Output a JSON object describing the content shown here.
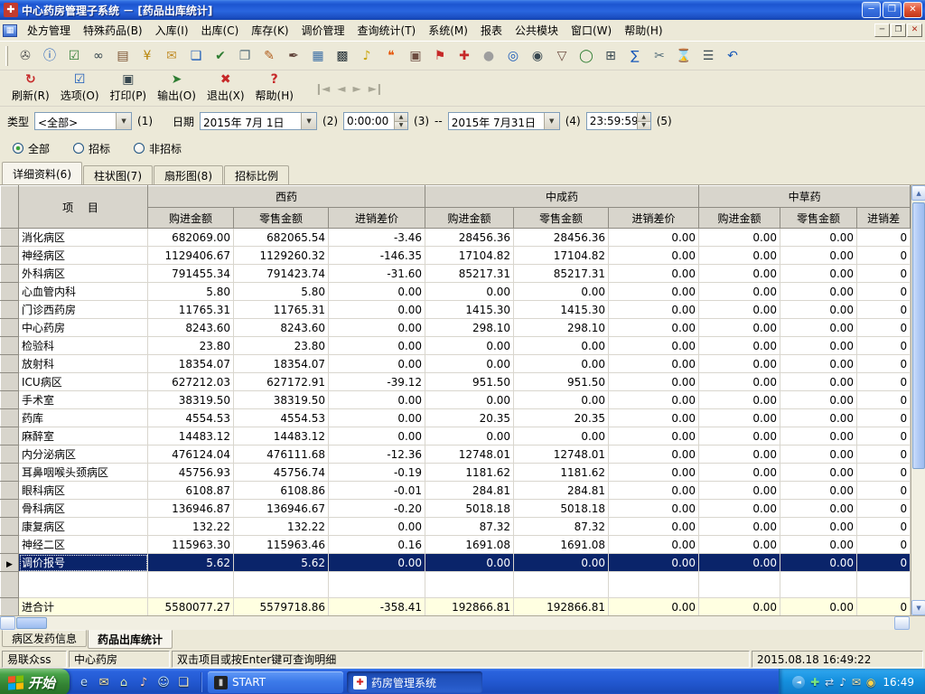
{
  "colors": {
    "window_face": "#ECE9D8",
    "header_bg": "#D8D5CC",
    "selection_bg": "#0A246A",
    "total_row_bg": "#FFFFE1",
    "grid_line": "#D9D6CE"
  },
  "window": {
    "title": "中心药房管理子系统 － [药品出库统计]",
    "icon_glyph": "✚",
    "controls": [
      {
        "name": "minimize-button",
        "glyph": "─"
      },
      {
        "name": "restore-button",
        "glyph": "❐"
      },
      {
        "name": "close-button",
        "glyph": "✕"
      }
    ]
  },
  "menubar": {
    "icon_glyph": "▦",
    "items": [
      "处方管理",
      "特殊药品(B)",
      "入库(I)",
      "出库(C)",
      "库存(K)",
      "调价管理",
      "查询统计(T)",
      "系统(M)",
      "报表",
      "公共模块",
      "窗口(W)",
      "帮助(H)"
    ],
    "controls": [
      {
        "name": "mdi-minimize-button",
        "glyph": "─"
      },
      {
        "name": "mdi-restore-button",
        "glyph": "❐"
      },
      {
        "name": "mdi-close-button",
        "glyph": "✕"
      }
    ]
  },
  "toolbar": {
    "icons": [
      {
        "name": "print-preview-icon",
        "glyph": "✇",
        "color": "#5A5A5A"
      },
      {
        "name": "info-icon",
        "glyph": "ⓘ",
        "color": "#1758B8"
      },
      {
        "name": "task-check-icon",
        "glyph": "☑",
        "color": "#2E7D32"
      },
      {
        "name": "binoculars-icon",
        "glyph": "∞",
        "color": "#37474F"
      },
      {
        "name": "ledger-icon",
        "glyph": "▤",
        "color": "#7A5230"
      },
      {
        "name": "cash-icon",
        "glyph": "¥",
        "color": "#B8860B"
      },
      {
        "name": "mail-icon",
        "glyph": "✉",
        "color": "#C28F2C"
      },
      {
        "name": "document-icon",
        "glyph": "❏",
        "color": "#1758B8"
      },
      {
        "name": "document-check-icon",
        "glyph": "✔",
        "color": "#2E7D32"
      },
      {
        "name": "copy-icon",
        "glyph": "❐",
        "color": "#546E7A"
      },
      {
        "name": "edit-icon",
        "glyph": "✎",
        "color": "#B05C1A"
      },
      {
        "name": "contract-icon",
        "glyph": "✒",
        "color": "#5D4037"
      },
      {
        "name": "report-icon",
        "glyph": "▦",
        "color": "#3A6EA5"
      },
      {
        "name": "barcode-icon",
        "glyph": "▩",
        "color": "#263238"
      },
      {
        "name": "bell-icon",
        "glyph": "♪",
        "color": "#C8A200"
      },
      {
        "name": "chat-icon",
        "glyph": "❝",
        "color": "#E65100"
      },
      {
        "name": "package-icon",
        "glyph": "▣",
        "color": "#6D4C41"
      },
      {
        "name": "flag-icon",
        "glyph": "⚑",
        "color": "#C62828"
      },
      {
        "name": "medicine-cross-icon",
        "glyph": "✚",
        "color": "#C62828"
      },
      {
        "name": "sphere-icon",
        "glyph": "●",
        "color": "#9E9E9E"
      },
      {
        "name": "search-icon",
        "glyph": "◎",
        "color": "#1758B8"
      },
      {
        "name": "zoom-icon",
        "glyph": "◉",
        "color": "#37474F"
      },
      {
        "name": "basket-icon",
        "glyph": "▽",
        "color": "#6D4C41"
      },
      {
        "name": "globe-icon",
        "glyph": "◯",
        "color": "#2E7D32"
      },
      {
        "name": "calculator-icon",
        "glyph": "⊞",
        "color": "#37474F"
      },
      {
        "name": "sum-icon",
        "glyph": "∑",
        "color": "#1758B8"
      },
      {
        "name": "scissors-icon",
        "glyph": "✂",
        "color": "#546E7A"
      },
      {
        "name": "hourglass-icon",
        "glyph": "⌛",
        "color": "#B8860B"
      },
      {
        "name": "list-icon",
        "glyph": "☰",
        "color": "#37474F"
      },
      {
        "name": "undo-icon",
        "glyph": "↶",
        "color": "#1758B8"
      }
    ]
  },
  "actions": {
    "buttons": [
      {
        "name": "refresh",
        "label": "刷新(R)",
        "icon": "refresh-icon",
        "glyph": "↻",
        "color": "#C62828"
      },
      {
        "name": "options",
        "label": "选项(O)",
        "icon": "options-icon",
        "glyph": "☑",
        "color": "#1758B8"
      },
      {
        "name": "print",
        "label": "打印(P)",
        "icon": "printer-icon",
        "glyph": "▣",
        "color": "#37474F"
      },
      {
        "name": "export",
        "label": "输出(O)",
        "icon": "export-icon",
        "glyph": "➤",
        "color": "#2E7D32"
      },
      {
        "name": "exit",
        "label": "退出(X)",
        "icon": "exit-icon",
        "glyph": "✖",
        "color": "#C62828"
      },
      {
        "name": "help",
        "label": "帮助(H)",
        "icon": "help-icon",
        "glyph": "?",
        "color": "#C62828"
      }
    ],
    "nav": [
      {
        "name": "first-record-icon",
        "glyph": "❙◄"
      },
      {
        "name": "prev-record-icon",
        "glyph": "◄"
      },
      {
        "name": "next-record-icon",
        "glyph": "►"
      },
      {
        "name": "last-record-icon",
        "glyph": "►❙"
      }
    ]
  },
  "filters": {
    "type_label": "类型",
    "type_value": "<全部>",
    "num1": "(1)",
    "date_label": "日期",
    "date_from": "2015年 7月 1日",
    "num2": "(2)",
    "time_from": "0:00:00",
    "num3": "(3)",
    "dash": "--",
    "date_to": "2015年 7月31日",
    "num4": "(4)",
    "time_to": "23:59:59",
    "num5": "(5)"
  },
  "radios": [
    {
      "label": "全部",
      "checked": true
    },
    {
      "label": "招标",
      "checked": false
    },
    {
      "label": "非招标",
      "checked": false
    }
  ],
  "view_tabs": [
    {
      "label": "详细资料(6)",
      "active": true
    },
    {
      "label": "柱状图(7)",
      "active": false
    },
    {
      "label": "扇形图(8)",
      "active": false
    },
    {
      "label": "招标比例",
      "active": false
    }
  ],
  "table": {
    "item_header": "项  目",
    "groups": [
      {
        "label": "西药",
        "span": 3
      },
      {
        "label": "中成药",
        "span": 3
      },
      {
        "label": "中草药",
        "span": 3
      }
    ],
    "sub_headers": [
      "购进金额",
      "零售金额",
      "进销差价",
      "购进金额",
      "零售金额",
      "进销差价",
      "购进金额",
      "零售金额",
      "进销差"
    ],
    "rows": [
      {
        "label": "消化病区",
        "cells": [
          "682069.00",
          "682065.54",
          "-3.46",
          "28456.36",
          "28456.36",
          "0.00",
          "0.00",
          "0.00",
          "0"
        ]
      },
      {
        "label": "神经病区",
        "cells": [
          "1129406.67",
          "1129260.32",
          "-146.35",
          "17104.82",
          "17104.82",
          "0.00",
          "0.00",
          "0.00",
          "0"
        ]
      },
      {
        "label": "外科病区",
        "cells": [
          "791455.34",
          "791423.74",
          "-31.60",
          "85217.31",
          "85217.31",
          "0.00",
          "0.00",
          "0.00",
          "0"
        ]
      },
      {
        "label": "心血管内科",
        "cells": [
          "5.80",
          "5.80",
          "0.00",
          "0.00",
          "0.00",
          "0.00",
          "0.00",
          "0.00",
          "0"
        ]
      },
      {
        "label": "门诊西药房",
        "cells": [
          "11765.31",
          "11765.31",
          "0.00",
          "1415.30",
          "1415.30",
          "0.00",
          "0.00",
          "0.00",
          "0"
        ]
      },
      {
        "label": "中心药房",
        "cells": [
          "8243.60",
          "8243.60",
          "0.00",
          "298.10",
          "298.10",
          "0.00",
          "0.00",
          "0.00",
          "0"
        ]
      },
      {
        "label": "检验科",
        "cells": [
          "23.80",
          "23.80",
          "0.00",
          "0.00",
          "0.00",
          "0.00",
          "0.00",
          "0.00",
          "0"
        ]
      },
      {
        "label": "放射科",
        "cells": [
          "18354.07",
          "18354.07",
          "0.00",
          "0.00",
          "0.00",
          "0.00",
          "0.00",
          "0.00",
          "0"
        ]
      },
      {
        "label": "ICU病区",
        "cells": [
          "627212.03",
          "627172.91",
          "-39.12",
          "951.50",
          "951.50",
          "0.00",
          "0.00",
          "0.00",
          "0"
        ]
      },
      {
        "label": "手术室",
        "cells": [
          "38319.50",
          "38319.50",
          "0.00",
          "0.00",
          "0.00",
          "0.00",
          "0.00",
          "0.00",
          "0"
        ]
      },
      {
        "label": "药库",
        "cells": [
          "4554.53",
          "4554.53",
          "0.00",
          "20.35",
          "20.35",
          "0.00",
          "0.00",
          "0.00",
          "0"
        ]
      },
      {
        "label": "麻醉室",
        "cells": [
          "14483.12",
          "14483.12",
          "0.00",
          "0.00",
          "0.00",
          "0.00",
          "0.00",
          "0.00",
          "0"
        ]
      },
      {
        "label": "内分泌病区",
        "cells": [
          "476124.04",
          "476111.68",
          "-12.36",
          "12748.01",
          "12748.01",
          "0.00",
          "0.00",
          "0.00",
          "0"
        ]
      },
      {
        "label": "耳鼻咽喉头颈病区",
        "cells": [
          "45756.93",
          "45756.74",
          "-0.19",
          "1181.62",
          "1181.62",
          "0.00",
          "0.00",
          "0.00",
          "0"
        ]
      },
      {
        "label": "眼科病区",
        "cells": [
          "6108.87",
          "6108.86",
          "-0.01",
          "284.81",
          "284.81",
          "0.00",
          "0.00",
          "0.00",
          "0"
        ]
      },
      {
        "label": "骨科病区",
        "cells": [
          "136946.87",
          "136946.67",
          "-0.20",
          "5018.18",
          "5018.18",
          "0.00",
          "0.00",
          "0.00",
          "0"
        ]
      },
      {
        "label": "康复病区",
        "cells": [
          "132.22",
          "132.22",
          "0.00",
          "87.32",
          "87.32",
          "0.00",
          "0.00",
          "0.00",
          "0"
        ]
      },
      {
        "label": "神经二区",
        "cells": [
          "115963.30",
          "115963.46",
          "0.16",
          "1691.08",
          "1691.08",
          "0.00",
          "0.00",
          "0.00",
          "0"
        ]
      },
      {
        "label": "调价报号",
        "cells": [
          "5.62",
          "5.62",
          "0.00",
          "0.00",
          "0.00",
          "0.00",
          "0.00",
          "0.00",
          "0"
        ],
        "selected": true
      },
      {
        "label": "",
        "cells": [
          "",
          "",
          "",
          "",
          "",
          "",
          "",
          "",
          ""
        ],
        "spacer": true
      },
      {
        "label": "进合计",
        "cells": [
          "5580077.27",
          "5579718.86",
          "-358.41",
          "192866.81",
          "192866.81",
          "0.00",
          "0.00",
          "0.00",
          "0"
        ],
        "total": true
      }
    ]
  },
  "bottom_tabs": [
    {
      "label": "病区发药信息",
      "active": false
    },
    {
      "label": "药品出库统计",
      "active": true
    }
  ],
  "statusbar": {
    "user": "易联众ss",
    "department": "中心药房",
    "hint": "双击项目或按Enter键可查询明细",
    "datetime": "2015.08.18 16:49:22"
  },
  "taskbar": {
    "start_label": "开始",
    "quick_launch": [
      {
        "name": "ie-icon",
        "glyph": "e",
        "color": "#BFE0FF"
      },
      {
        "name": "outlook-icon",
        "glyph": "✉",
        "color": "#FFE9A8"
      },
      {
        "name": "show-desktop-icon",
        "glyph": "⌂",
        "color": "#D8F0C8"
      },
      {
        "name": "media-player-icon",
        "glyph": "♪",
        "color": "#FFD0C0"
      },
      {
        "name": "messenger-icon",
        "glyph": "☺",
        "color": "#C8E8FF"
      },
      {
        "name": "folder-icon",
        "glyph": "❏",
        "color": "#FFF3C0"
      }
    ],
    "tasks": [
      {
        "name": "task-start-console",
        "label": "START",
        "icon": "console-icon",
        "glyph": "▮",
        "icon_bg": "#222222",
        "icon_color": "#CCCCCC",
        "active": false
      },
      {
        "name": "task-pharmacy-system",
        "label": "药房管理系统",
        "icon": "pharmacy-icon",
        "glyph": "✚",
        "icon_bg": "#FFFFFF",
        "icon_color": "#D22222",
        "active": true
      }
    ],
    "tray_icons": [
      {
        "name": "tray-health-icon",
        "glyph": "✚",
        "color": "#7CE87C"
      },
      {
        "name": "tray-network-icon",
        "glyph": "⇄",
        "color": "#D8ECFF"
      },
      {
        "name": "tray-volume-icon",
        "glyph": "♪",
        "color": "#FFFFFF"
      },
      {
        "name": "tray-message-icon",
        "glyph": "✉",
        "color": "#FFE9A8"
      },
      {
        "name": "tray-shield-icon",
        "glyph": "◉",
        "color": "#FFD34D"
      }
    ],
    "clock": "16:49"
  }
}
